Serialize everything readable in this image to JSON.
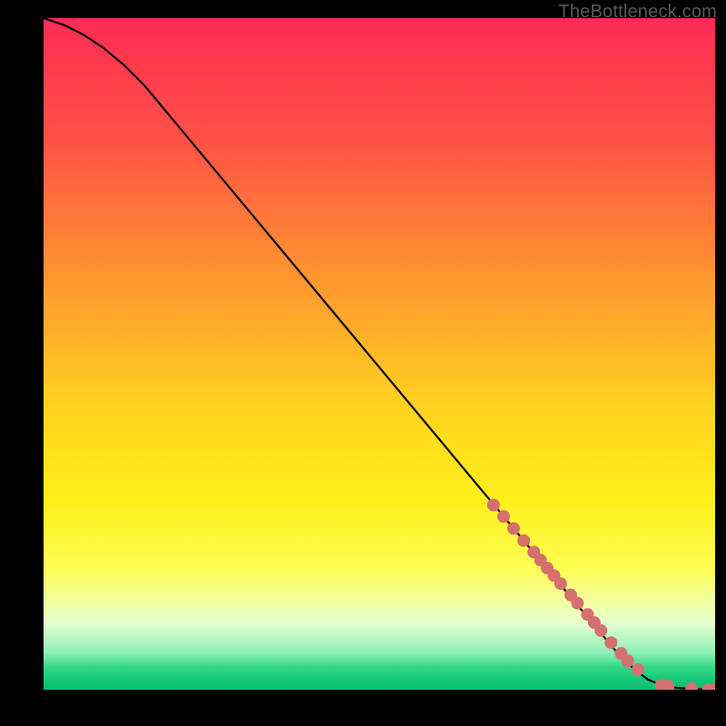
{
  "watermark": "TheBottleneck.com",
  "chart_data": {
    "type": "line",
    "title": "",
    "xlabel": "",
    "ylabel": "",
    "xlim": [
      0,
      100
    ],
    "ylim": [
      0,
      100
    ],
    "grid": false,
    "series": [
      {
        "name": "curve",
        "color": "#000000",
        "x": [
          0,
          3,
          6,
          9,
          12,
          15,
          20,
          30,
          40,
          50,
          60,
          70,
          80,
          85,
          88,
          90,
          92,
          94,
          96,
          98,
          100
        ],
        "y": [
          100,
          99,
          97.5,
          95.5,
          93,
          90,
          84,
          72,
          60,
          48,
          36,
          24,
          12,
          6,
          3,
          1.5,
          0.7,
          0.3,
          0.15,
          0.05,
          0
        ]
      }
    ],
    "markers": {
      "name": "highlight-points",
      "color": "#d6706f",
      "radius_px": 7,
      "x": [
        67,
        68.5,
        70,
        71.5,
        73,
        74,
        75,
        76,
        77,
        78.5,
        79.5,
        81,
        82,
        83,
        84.5,
        86,
        87,
        88.5,
        92,
        93,
        96.5,
        99,
        100
      ],
      "y": [
        27.5,
        25.8,
        24,
        22.2,
        20.5,
        19.3,
        18.1,
        17,
        15.8,
        14.1,
        12.9,
        11.2,
        10,
        8.8,
        7,
        5.4,
        4.3,
        3,
        0.7,
        0.5,
        0.15,
        0,
        0
      ]
    },
    "background_gradient_stops": [
      {
        "offset": 0.0,
        "color": "#ff2c55"
      },
      {
        "offset": 0.18,
        "color": "#ff5146"
      },
      {
        "offset": 0.4,
        "color": "#ff9a2f"
      },
      {
        "offset": 0.58,
        "color": "#ffd21f"
      },
      {
        "offset": 0.72,
        "color": "#fff01a"
      },
      {
        "offset": 0.82,
        "color": "#ffff55"
      },
      {
        "offset": 0.9,
        "color": "#e8ffd0"
      },
      {
        "offset": 0.945,
        "color": "#8ff0b8"
      },
      {
        "offset": 0.965,
        "color": "#36d989"
      },
      {
        "offset": 0.985,
        "color": "#12c878"
      },
      {
        "offset": 1.0,
        "color": "#0fbf72"
      }
    ]
  }
}
